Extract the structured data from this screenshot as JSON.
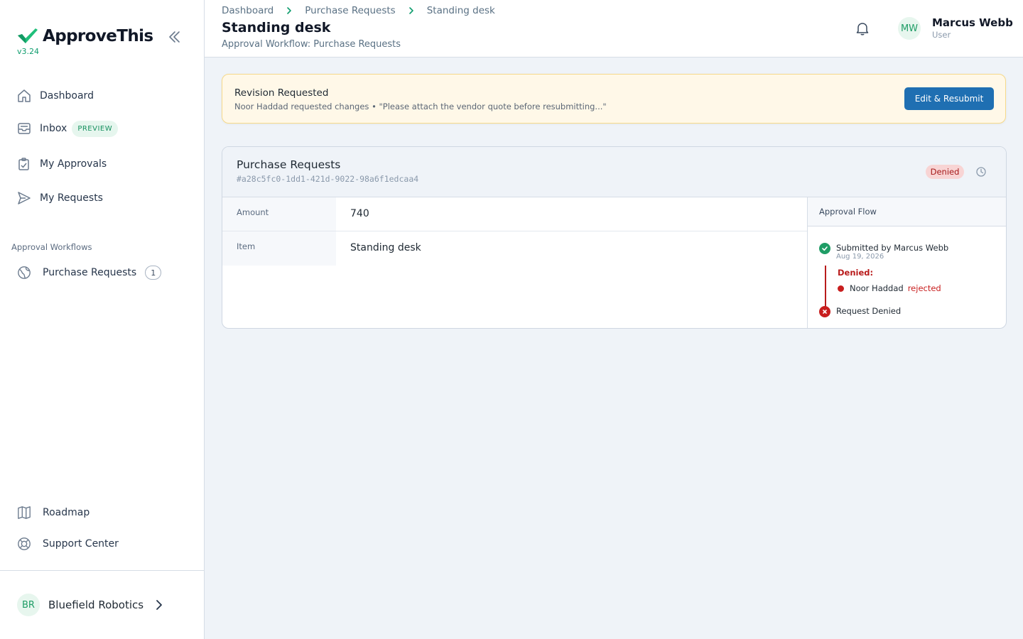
{
  "app": {
    "name": "ApproveThis",
    "version": "v3.24"
  },
  "sidebar": {
    "items": [
      {
        "label": "Dashboard"
      },
      {
        "label": "Inbox",
        "badge": "PREVIEW"
      },
      {
        "label": "My Approvals"
      },
      {
        "label": "My Requests"
      }
    ],
    "section_title": "Approval Workflows",
    "workflows": [
      {
        "label": "Purchase Requests",
        "count": "1"
      }
    ],
    "footer_items": [
      {
        "label": "Roadmap"
      },
      {
        "label": "Support Center"
      }
    ],
    "org": {
      "initials": "BR",
      "name": "Bluefield Robotics"
    }
  },
  "header": {
    "breadcrumb": [
      "Dashboard",
      "Purchase Requests",
      "Standing desk"
    ],
    "title": "Standing desk",
    "subtitle": "Approval Workflow: Purchase Requests",
    "user": {
      "initials": "MW",
      "name": "Marcus Webb",
      "role": "User"
    }
  },
  "banner": {
    "title": "Revision Requested",
    "message": "Noor Haddad requested changes • \"Please attach the vendor quote before resubmitting...\"",
    "button": "Edit & Resubmit"
  },
  "request": {
    "title": "Purchase Requests",
    "id": "#a28c5fc0-1dd1-421d-9022-98a6f1edcaa4",
    "status": "Denied",
    "fields": [
      {
        "label": "Amount",
        "value": "740"
      },
      {
        "label": "Item",
        "value": "Standing desk"
      }
    ]
  },
  "flow": {
    "heading": "Approval Flow",
    "submitted": {
      "text": "Submitted by Marcus Webb",
      "date": "Aug 19, 2026"
    },
    "stage_label": "Denied:",
    "approver": {
      "name": "Noor Haddad",
      "status": "rejected"
    },
    "final": "Request Denied"
  },
  "colors": {
    "brand_green": "#1fbf7a",
    "primary_button": "#1f6fb2",
    "denied_red": "#b91c1c",
    "banner_bg": "#fff8e8"
  }
}
